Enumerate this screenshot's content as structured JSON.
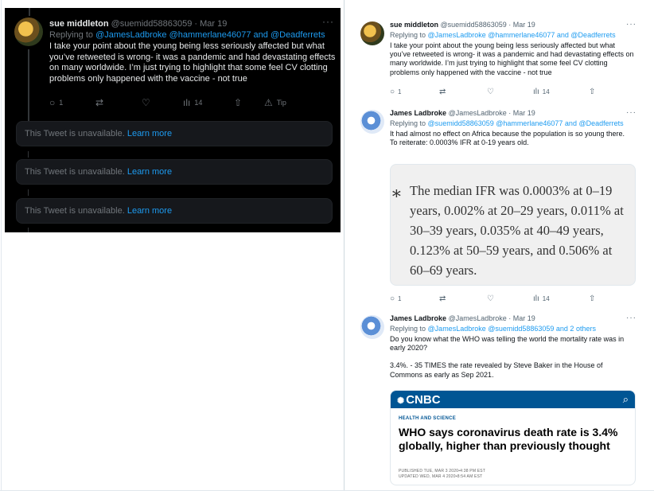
{
  "dark_panel": {
    "tweet": {
      "name": "sue middleton",
      "handle": "@suemidd58863059",
      "sep": "·",
      "date": "Mar 19",
      "more": "···",
      "reply_prefix": "Replying to",
      "reply_to": "@JamesLadbroke @hammerlane46077 and @Deadferrets",
      "body": "I take your point about the young being less seriously affected but what you’ve retweeted is wrong- it was a pandemic and had devastating effects on many worldwide. I’m just trying to highlight that some feel CV clotting problems only happened with the vaccine - not true",
      "replies": "1",
      "views": "14",
      "tip": "Tip"
    },
    "unavailable": [
      {
        "text": "This Tweet is unavailable.",
        "link": "Learn more"
      },
      {
        "text": "This Tweet is unavailable.",
        "link": "Learn more"
      },
      {
        "text": "This Tweet is unavailable.",
        "link": "Learn more"
      }
    ]
  },
  "light_panel": {
    "tweet1": {
      "name": "sue middleton",
      "handle": "@suemidd58863059",
      "sep": "·",
      "date": "Mar 19",
      "more": "···",
      "reply_prefix": "Replying to",
      "reply_to": "@JamesLadbroke @hammerlane46077 and @Deadferrets",
      "body": "I take your point about the young being less seriously affected but what you’ve retweeted is wrong- it was a pandemic and had devastating effects on many worldwide. I’m just trying to highlight that some feel CV clotting problems only happened with the vaccine - not true",
      "replies": "1",
      "views": "14"
    },
    "tweet2": {
      "name": "James Ladbroke",
      "handle": "@JamesLadbroke",
      "sep": "·",
      "date": "Mar 19",
      "more": "···",
      "reply_prefix": "Replying to",
      "reply_to": "@suemidd58863059 @hammerlane46077 and @Deadferrets",
      "body_line1": "It had almost no effect on Africa because the population is so young there.",
      "body_line2": "To reiterate: 0.0003% IFR at 0-19 years old.",
      "quote_star": "∗",
      "quote": "The median IFR was 0.0003% at 0–19 years, 0.002% at 20–29 years, 0.011% at 30–39 years, 0.035% at 40–49 years, 0.123% at 50–59 years, and 0.506% at 60–69 years.",
      "replies": "1",
      "views": "14"
    },
    "tweet3": {
      "name": "James Ladbroke",
      "handle": "@JamesLadbroke",
      "sep": "·",
      "date": "Mar 19",
      "more": "···",
      "reply_prefix": "Replying to",
      "reply_to": "@JamesLadbroke @suemidd58863059 and 2 others",
      "body_line1": "Do you know what the WHO was telling the world the mortality rate was in early 2020?",
      "body_line2": "3.4%. - 35 TIMES the rate revealed by Steve Baker in the House of Commons as early as Sep 2021.",
      "card": {
        "logo": "CNBC",
        "section": "HEALTH AND SCIENCE",
        "headline": "WHO says coronavirus death rate is 3.4% globally, higher than previously thought",
        "published": "PUBLISHED TUE, MAR 3 2020•4:38 PM EST",
        "updated": "UPDATED WED, MAR 4 2020•8:54 AM EST"
      }
    }
  },
  "icons": {
    "reply": "○",
    "retweet": "⇄",
    "like": "♡",
    "views": "ılı",
    "share": "⇧",
    "tip": "⚠",
    "search": "⌕",
    "peacock": "✺"
  },
  "colors": {
    "link_blue": "#1d9bf0",
    "dark_bg": "#000000",
    "cnbc_blue": "#005594"
  }
}
